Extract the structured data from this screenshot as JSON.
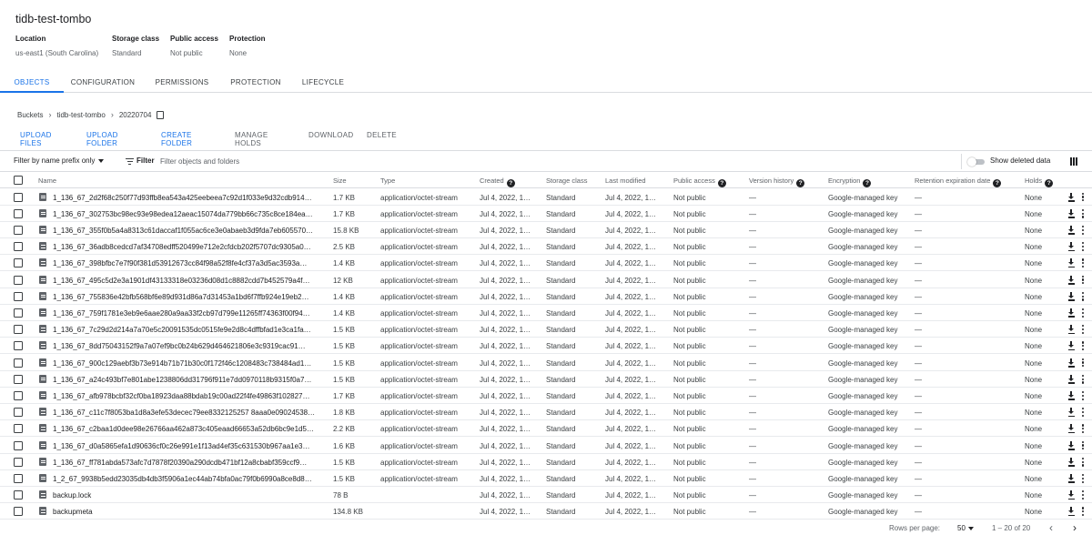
{
  "bucket": {
    "title": "tidb-test-tombo",
    "meta": [
      {
        "key": "Location",
        "value": "us-east1 (South Carolina)"
      },
      {
        "key": "Storage class",
        "value": "Standard"
      },
      {
        "key": "Public access",
        "value": "Not public"
      },
      {
        "key": "Protection",
        "value": "None"
      }
    ]
  },
  "tabs": [
    "OBJECTS",
    "CONFIGURATION",
    "PERMISSIONS",
    "PROTECTION",
    "LIFECYCLE"
  ],
  "breadcrumb": [
    "Buckets",
    "tidb-test-tombo",
    "20220704"
  ],
  "actions": [
    "UPLOAD FILES",
    "UPLOAD FOLDER",
    "CREATE FOLDER",
    "MANAGE HOLDS",
    "DOWNLOAD",
    "DELETE"
  ],
  "filterbar": {
    "prefix_select": "Filter by name prefix only",
    "filter_label": "Filter",
    "placeholder": "Filter objects and folders",
    "show_deleted": "Show deleted data"
  },
  "columns": [
    "Name",
    "Size",
    "Type",
    "Created",
    "Storage class",
    "Last modified",
    "Public access",
    "Version history",
    "Encryption",
    "Retention expiration date",
    "Holds"
  ],
  "rows": [
    {
      "name": "1_136_67_2d2f68c250f77d93ffb8ea543a425eebeea7c92d1f033e9d32cdb914…",
      "size": "1.7 KB",
      "type": "application/octet-stream",
      "created": "Jul 4, 2022, 1…",
      "storage": "Standard",
      "modified": "Jul 4, 2022, 1…",
      "public": "Not public",
      "version": "—",
      "encryption": "Google-managed key",
      "retention": "—",
      "holds": "None"
    },
    {
      "name": "1_136_67_302753bc98ec93e98edea12aeac15074da779bb66c735c8ce184ea…",
      "size": "1.7 KB",
      "type": "application/octet-stream",
      "created": "Jul 4, 2022, 1…",
      "storage": "Standard",
      "modified": "Jul 4, 2022, 1…",
      "public": "Not public",
      "version": "—",
      "encryption": "Google-managed key",
      "retention": "—",
      "holds": "None"
    },
    {
      "name": "1_136_67_355f0b5a4a8313c61daccaf1f055ac6ce3e0abaeb3d9fda7eb605570…",
      "size": "15.8 KB",
      "type": "application/octet-stream",
      "created": "Jul 4, 2022, 1…",
      "storage": "Standard",
      "modified": "Jul 4, 2022, 1…",
      "public": "Not public",
      "version": "—",
      "encryption": "Google-managed key",
      "retention": "—",
      "holds": "None"
    },
    {
      "name": "1_136_67_36adb8cedcd7af34708edff520499e712e2cfdcb202f5707dc9305a0…",
      "size": "2.5 KB",
      "type": "application/octet-stream",
      "created": "Jul 4, 2022, 1…",
      "storage": "Standard",
      "modified": "Jul 4, 2022, 1…",
      "public": "Not public",
      "version": "—",
      "encryption": "Google-managed key",
      "retention": "—",
      "holds": "None"
    },
    {
      "name": "1_136_67_398bfbc7e7f90f381d53912673cc84f98a52f8fe4cf37a3d5ac3593a…",
      "size": "1.4 KB",
      "type": "application/octet-stream",
      "created": "Jul 4, 2022, 1…",
      "storage": "Standard",
      "modified": "Jul 4, 2022, 1…",
      "public": "Not public",
      "version": "—",
      "encryption": "Google-managed key",
      "retention": "—",
      "holds": "None"
    },
    {
      "name": "1_136_67_495c5d2e3a1901df43133318e03236d08d1c8882cdd7b452579a4f…",
      "size": "12 KB",
      "type": "application/octet-stream",
      "created": "Jul 4, 2022, 1…",
      "storage": "Standard",
      "modified": "Jul 4, 2022, 1…",
      "public": "Not public",
      "version": "—",
      "encryption": "Google-managed key",
      "retention": "—",
      "holds": "None"
    },
    {
      "name": "1_136_67_755836e42bfb568bf6e89d931d86a7d31453a1bd6f7ffb924e19eb2…",
      "size": "1.4 KB",
      "type": "application/octet-stream",
      "created": "Jul 4, 2022, 1…",
      "storage": "Standard",
      "modified": "Jul 4, 2022, 1…",
      "public": "Not public",
      "version": "—",
      "encryption": "Google-managed key",
      "retention": "—",
      "holds": "None"
    },
    {
      "name": "1_136_67_759f1781e3eb9e6aae280a9aa33f2cb97d799e11265ff74363f00f94…",
      "size": "1.4 KB",
      "type": "application/octet-stream",
      "created": "Jul 4, 2022, 1…",
      "storage": "Standard",
      "modified": "Jul 4, 2022, 1…",
      "public": "Not public",
      "version": "—",
      "encryption": "Google-managed key",
      "retention": "—",
      "holds": "None"
    },
    {
      "name": "1_136_67_7c29d2d214a7a70e5c20091535dc0515fe9e2d8c4dffbfad1e3ca1fa…",
      "size": "1.5 KB",
      "type": "application/octet-stream",
      "created": "Jul 4, 2022, 1…",
      "storage": "Standard",
      "modified": "Jul 4, 2022, 1…",
      "public": "Not public",
      "version": "—",
      "encryption": "Google-managed key",
      "retention": "—",
      "holds": "None"
    },
    {
      "name": "1_136_67_8dd75043152f9a7a07ef9bc0b24b629d464621806e3c9319cac91…",
      "size": "1.5 KB",
      "type": "application/octet-stream",
      "created": "Jul 4, 2022, 1…",
      "storage": "Standard",
      "modified": "Jul 4, 2022, 1…",
      "public": "Not public",
      "version": "—",
      "encryption": "Google-managed key",
      "retention": "—",
      "holds": "None"
    },
    {
      "name": "1_136_67_900c129aebf3b73e914b71b71b30c0f172f46c1208483c738484ad1…",
      "size": "1.5 KB",
      "type": "application/octet-stream",
      "created": "Jul 4, 2022, 1…",
      "storage": "Standard",
      "modified": "Jul 4, 2022, 1…",
      "public": "Not public",
      "version": "—",
      "encryption": "Google-managed key",
      "retention": "—",
      "holds": "None"
    },
    {
      "name": "1_136_67_a24c493bf7e801abe1238806dd31796f911e7dd0970118b9315f0a7…",
      "size": "1.5 KB",
      "type": "application/octet-stream",
      "created": "Jul 4, 2022, 1…",
      "storage": "Standard",
      "modified": "Jul 4, 2022, 1…",
      "public": "Not public",
      "version": "—",
      "encryption": "Google-managed key",
      "retention": "—",
      "holds": "None"
    },
    {
      "name": "1_136_67_afb978bcbf32cf0ba18923daa88bdab19c00ad22f4fe49863f102827…",
      "size": "1.7 KB",
      "type": "application/octet-stream",
      "created": "Jul 4, 2022, 1…",
      "storage": "Standard",
      "modified": "Jul 4, 2022, 1…",
      "public": "Not public",
      "version": "—",
      "encryption": "Google-managed key",
      "retention": "—",
      "holds": "None"
    },
    {
      "name": "1_136_67_c11c7f8053ba1d8a3efe53decec79ee8332125257 8aaa0e09024538…",
      "size": "1.8 KB",
      "type": "application/octet-stream",
      "created": "Jul 4, 2022, 1…",
      "storage": "Standard",
      "modified": "Jul 4, 2022, 1…",
      "public": "Not public",
      "version": "—",
      "encryption": "Google-managed key",
      "retention": "—",
      "holds": "None"
    },
    {
      "name": "1_136_67_c2baa1d0dee98e26766aa462a873c405eaad66653a52db6bc9e1d5…",
      "size": "2.2 KB",
      "type": "application/octet-stream",
      "created": "Jul 4, 2022, 1…",
      "storage": "Standard",
      "modified": "Jul 4, 2022, 1…",
      "public": "Not public",
      "version": "—",
      "encryption": "Google-managed key",
      "retention": "—",
      "holds": "None"
    },
    {
      "name": "1_136_67_d0a5865efa1d90636cf0c26e991e1f13ad4ef35c631530b967aa1e3…",
      "size": "1.6 KB",
      "type": "application/octet-stream",
      "created": "Jul 4, 2022, 1…",
      "storage": "Standard",
      "modified": "Jul 4, 2022, 1…",
      "public": "Not public",
      "version": "—",
      "encryption": "Google-managed key",
      "retention": "—",
      "holds": "None"
    },
    {
      "name": "1_136_67_ff781abda573afc7d7878f20390a290dcdb471bf12a8cbabf359ccf9…",
      "size": "1.5 KB",
      "type": "application/octet-stream",
      "created": "Jul 4, 2022, 1…",
      "storage": "Standard",
      "modified": "Jul 4, 2022, 1…",
      "public": "Not public",
      "version": "—",
      "encryption": "Google-managed key",
      "retention": "—",
      "holds": "None"
    },
    {
      "name": "1_2_67_9938b5edd23035db4db3f5906a1ec44ab74bfa0ac79f0b6990a8ce8d8…",
      "size": "1.5 KB",
      "type": "application/octet-stream",
      "created": "Jul 4, 2022, 1…",
      "storage": "Standard",
      "modified": "Jul 4, 2022, 1…",
      "public": "Not public",
      "version": "—",
      "encryption": "Google-managed key",
      "retention": "—",
      "holds": "None"
    },
    {
      "name": "backup.lock",
      "size": "78 B",
      "type": "",
      "created": "Jul 4, 2022, 1…",
      "storage": "Standard",
      "modified": "Jul 4, 2022, 1…",
      "public": "Not public",
      "version": "—",
      "encryption": "Google-managed key",
      "retention": "—",
      "holds": "None"
    },
    {
      "name": "backupmeta",
      "size": "134.8 KB",
      "type": "",
      "created": "Jul 4, 2022, 1…",
      "storage": "Standard",
      "modified": "Jul 4, 2022, 1…",
      "public": "Not public",
      "version": "—",
      "encryption": "Google-managed key",
      "retention": "—",
      "holds": "None"
    }
  ],
  "pagination": {
    "rows_per_page_label": "Rows per page:",
    "rows_per_page": "50",
    "range": "1 – 20 of 20",
    "prev_icon": "chevron-left-icon",
    "next_icon": "chevron-right-icon"
  },
  "colors": {
    "accent": "#1a73e8",
    "text": "#202124",
    "muted": "#5f6368",
    "border": "#dadce0"
  }
}
